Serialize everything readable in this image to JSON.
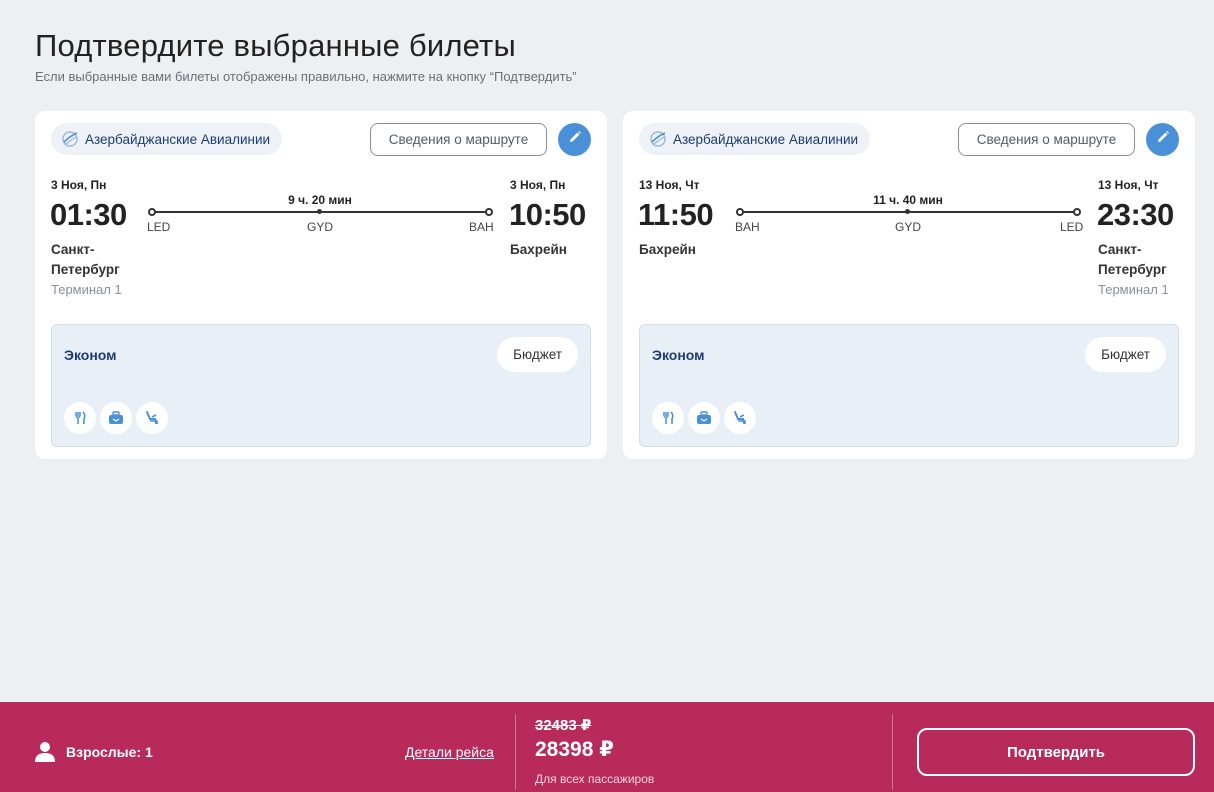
{
  "header": {
    "title": "Подтвердите выбранные билеты",
    "subtitle": "Если выбранные вами билеты отображены правильно, нажмите на кнопку “Подтвердить”"
  },
  "flights": [
    {
      "airline": "Азербайджанские Авиалинии",
      "route_button": "Сведения о маршруте",
      "dep_date": "3 Ноя, Пн",
      "dep_time": "01:30",
      "dep_city": "Санкт-Петербург",
      "dep_terminal": "Терминал 1",
      "arr_date": "3 Ноя, Пн",
      "arr_time": "10:50",
      "arr_city": "Бахрейн",
      "duration": "9 ч. 20 мин",
      "codes": [
        "LED",
        "GYD",
        "BAH"
      ],
      "fare_class": "Эконом",
      "fare_tag": "Бюджет",
      "amenities": [
        "meal-icon",
        "baggage-icon",
        "seat-icon"
      ]
    },
    {
      "airline": "Азербайджанские Авиалинии",
      "route_button": "Сведения о маршруте",
      "dep_date": "13 Ноя, Чт",
      "dep_time": "11:50",
      "dep_city": "Бахрейн",
      "arr_date": "13 Ноя, Чт",
      "arr_time": "23:30",
      "arr_city": "Санкт-Петербург",
      "arr_terminal": "Терминал 1",
      "duration": "11 ч. 40 мин",
      "codes": [
        "BAH",
        "GYD",
        "LED"
      ],
      "fare_class": "Эконом",
      "fare_tag": "Бюджет",
      "amenities": [
        "meal-icon",
        "baggage-icon",
        "seat-icon"
      ]
    }
  ],
  "footer": {
    "passengers": "Взрослые: 1",
    "details_link": "Детали рейса",
    "old_price": "32483 ₽",
    "new_price": "28398 ₽",
    "price_note": "Для всех пассажиров",
    "confirm": "Подтвердить"
  },
  "colors": {
    "accent": "#4a90d9",
    "footer_bg": "#b82a5a",
    "brand_text": "#1f3b73",
    "fare_bg": "#e9eff7"
  }
}
